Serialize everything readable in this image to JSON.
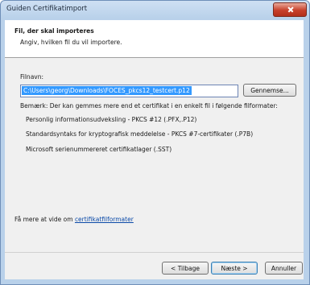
{
  "window": {
    "title": "Guiden Certifikatimport"
  },
  "header": {
    "title": "Fil, der skal importeres",
    "subtitle": "Angiv, hvilken fil du vil importere."
  },
  "file": {
    "label": "Filnavn:",
    "value": "C:\\Users\\georg\\Downloads\\FOCES_pkcs12_testcert.p12",
    "browse_label": "Gennemse..."
  },
  "note": {
    "text": "Bemærk: Der kan gemmes mere end et certifikat i en enkelt fil i følgende filformater:",
    "formats": [
      "Personlig informationsudveksling - PKCS #12 (.PFX,.P12)",
      "Standardsyntaks for kryptografisk meddelelse - PKCS #7-certifikater (.P7B)",
      "Microsoft serienummereret certifikatlager (.SST)"
    ]
  },
  "learn_more": {
    "prefix": "Få mere at vide om ",
    "link": "certifikatfilformater"
  },
  "buttons": {
    "back": "< Tilbage",
    "next": "Næste >",
    "cancel": "Annuller"
  }
}
